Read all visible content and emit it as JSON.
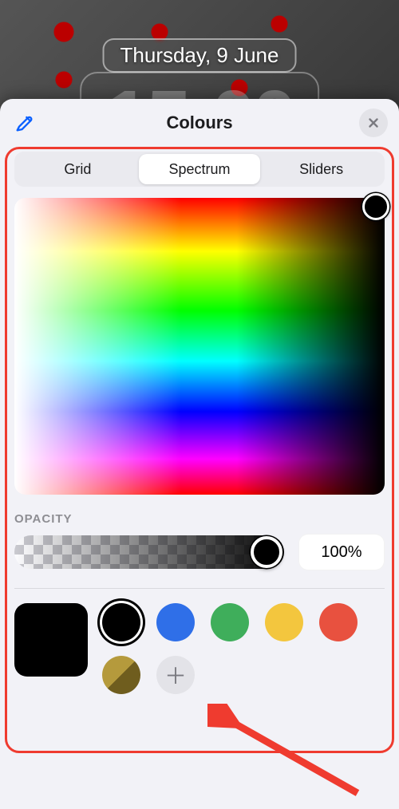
{
  "lockscreen": {
    "date": "Thursday, 9 June"
  },
  "sheet": {
    "title": "Colours",
    "tabs": {
      "grid": "Grid",
      "spectrum": "Spectrum",
      "sliders": "Sliders"
    },
    "opacity_label": "OPACITY",
    "opacity_value": "100%",
    "selected_color": "#000000",
    "presets": [
      {
        "color": "#000000",
        "selected": true
      },
      {
        "color": "#2F6FE8"
      },
      {
        "color": "#3FAE5B"
      },
      {
        "color": "#F3C63E"
      },
      {
        "color": "#E8513F"
      }
    ]
  }
}
